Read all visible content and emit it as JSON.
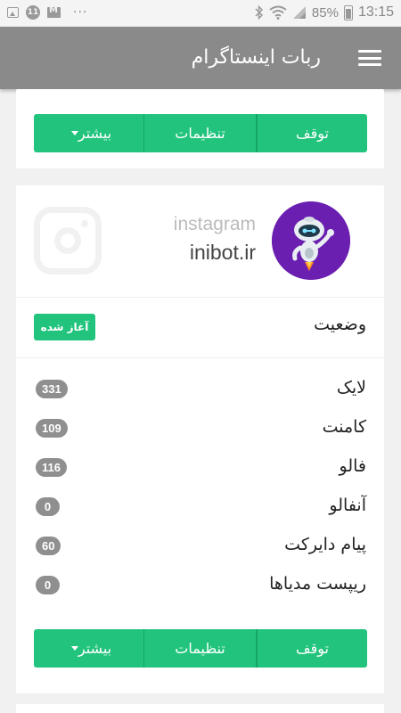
{
  "statusbar": {
    "notif_count": "11",
    "battery": "85%",
    "time": "13:15",
    "icons": [
      "image-icon",
      "notification-circle-icon",
      "mail-icon",
      "more-dots-icon",
      "bluetooth-icon",
      "wifi-icon",
      "signal-icon",
      "battery-charging-icon"
    ]
  },
  "appbar": {
    "title": "ربات اینستاگرام",
    "menu_icon": "hamburger-menu-icon"
  },
  "top_card": {
    "buttons": {
      "stop": "توقف",
      "settings": "تنظیمات",
      "more": "بیشتر"
    }
  },
  "account": {
    "platform": "instagram",
    "username": "inibot.ir",
    "status_label": "وضعیت",
    "status_badge": "آغاز شده",
    "stats": [
      {
        "label": "لایک",
        "count": "331"
      },
      {
        "label": "کامنت",
        "count": "109"
      },
      {
        "label": "فالو",
        "count": "116"
      },
      {
        "label": "آنفالو",
        "count": "0"
      },
      {
        "label": "پیام دایرکت",
        "count": "60"
      },
      {
        "label": "ریپست مدیاها",
        "count": "0"
      }
    ],
    "buttons": {
      "stop": "توقف",
      "settings": "تنظیمات",
      "more": "بیشتر"
    }
  },
  "colors": {
    "appbar": "#8a8a8a",
    "accent_green": "#22c47d",
    "badge_gray": "#8f8f8f",
    "avatar_purple": "#6a1fb0"
  }
}
